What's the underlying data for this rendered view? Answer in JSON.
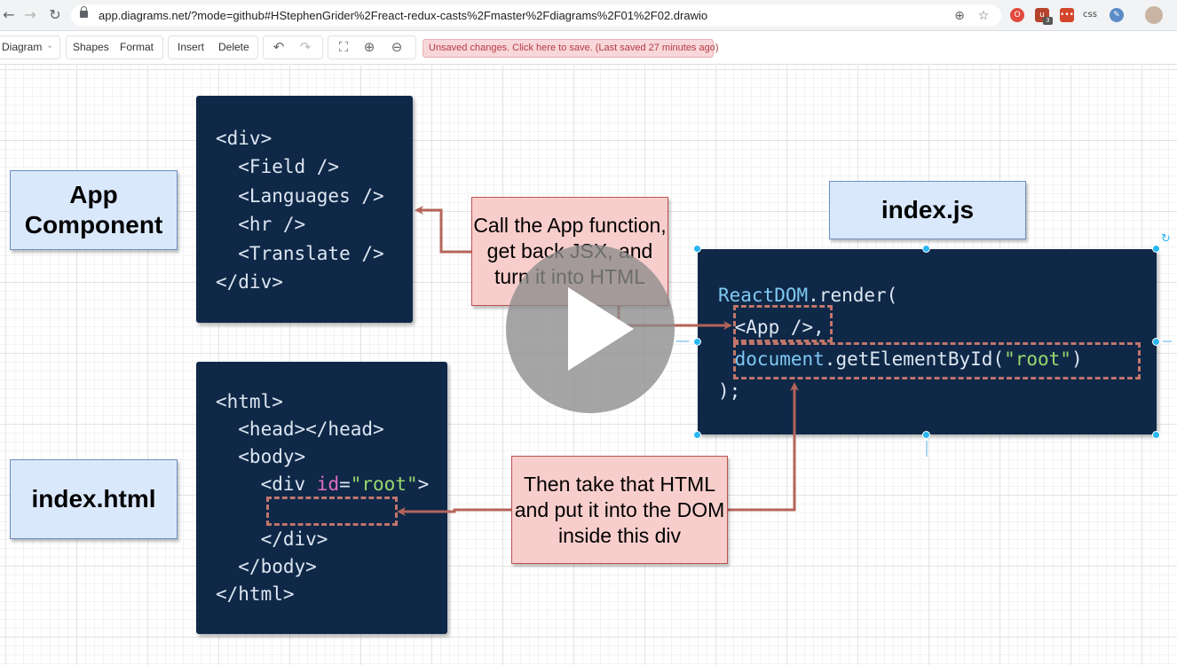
{
  "browser": {
    "url": "app.diagrams.net/?mode=github#HStephenGrider%2Freact-redux-casts%2Fmaster%2Fdiagrams%2F01%2F02.drawio",
    "extension_badge": "3",
    "extension_css_label": "css"
  },
  "toolbar": {
    "diagram_menu": "Diagram",
    "shapes": "Shapes",
    "format": "Format",
    "insert": "Insert",
    "delete": "Delete",
    "unsaved_notice": "Unsaved changes. Click here to save. (Last saved 27 minutes ago)"
  },
  "diagram": {
    "app_component_label": "App\nComponent",
    "index_js_label": "index.js",
    "index_html_label": "index.html",
    "jsx_code": [
      "<div>",
      "  <Field />",
      "  <Languages />",
      "  <hr />",
      "  <Translate />",
      "</div>"
    ],
    "html_code": {
      "l1": "<html>",
      "l2": "  <head></head>",
      "l3": "  <body>",
      "l4_tag": "    <div ",
      "l4_attr": "id",
      "l4_eq": "=",
      "l4_val": "\"root\"",
      "l4_close": ">",
      "l5": "    </div>",
      "l6": "  </body>",
      "l7": "</html>"
    },
    "js_code": {
      "l1_obj": "ReactDOM",
      "l1_rest": ".render(",
      "l2": " <App />,",
      "l3_obj": " document",
      "l3_method": ".getElementById(",
      "l3_str": "\"root\"",
      "l3_close": ")",
      "l4": ");"
    },
    "note_call_app": "Call the App function, get back JSX, and turn it into HTML",
    "note_take_html": "Then take that HTML and put it into the DOM inside this div"
  },
  "colors": {
    "code_bg": "#0f2847",
    "label_fill": "#dae8fc",
    "note_fill": "#f8cecc",
    "arrow": "#b5645a"
  }
}
